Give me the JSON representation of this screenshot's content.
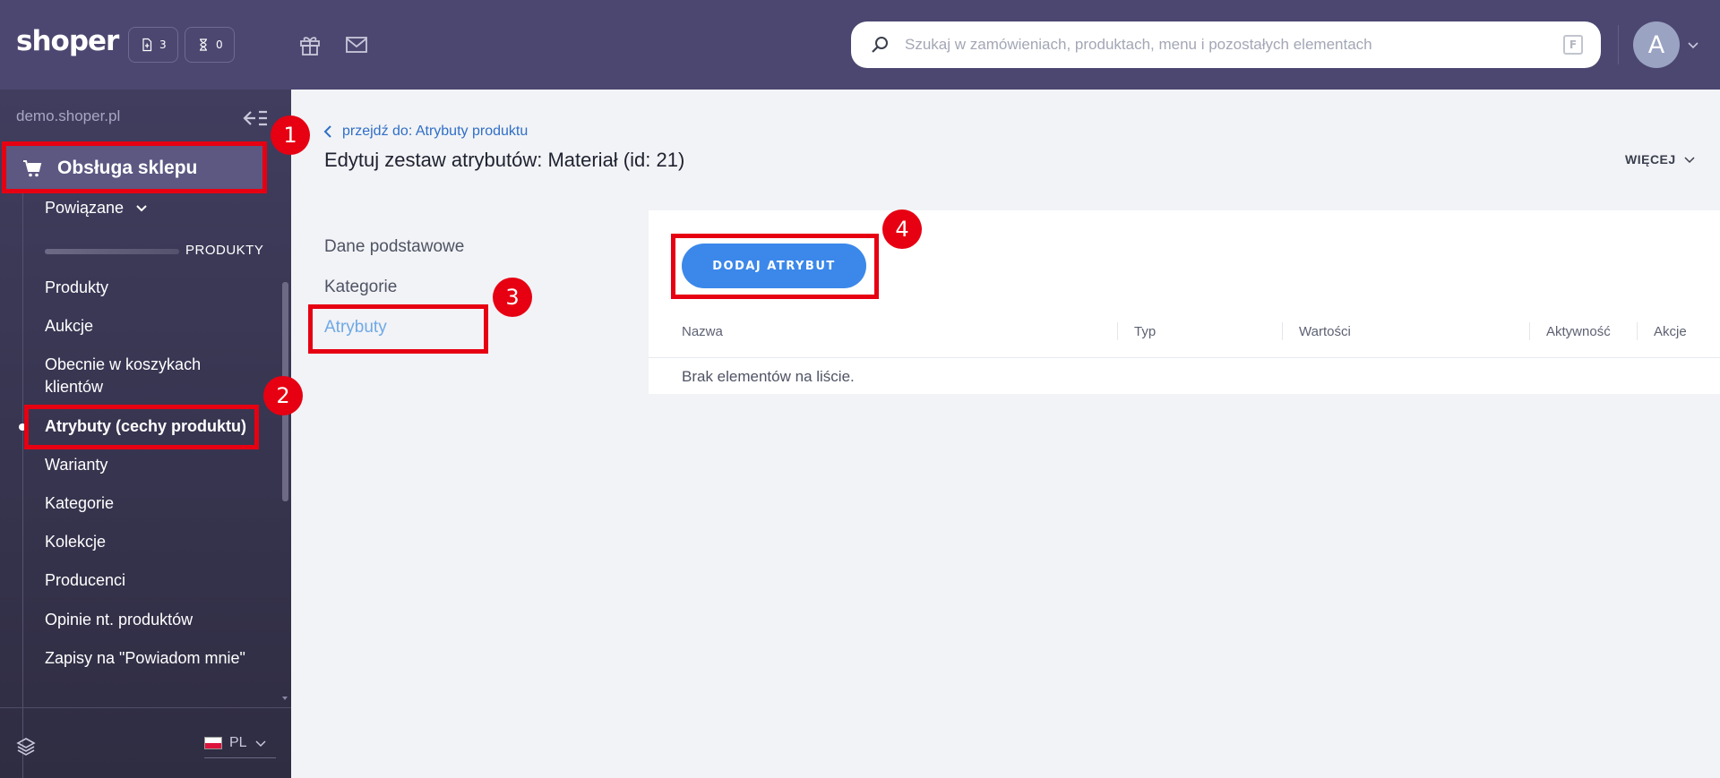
{
  "header": {
    "logo": "shoper",
    "orders_count": "3",
    "pending_count": "0",
    "search_placeholder": "Szukaj w zamówieniach, produktach, menu i pozostałych elementach",
    "search_shortcut": "F",
    "avatar_initial": "A"
  },
  "sidebar": {
    "shop_url": "demo.shoper.pl",
    "section_title": "Obsługa sklepu",
    "related_label": "Powiązane",
    "group_label": "PRODUKTY",
    "items": [
      {
        "label": "Produkty"
      },
      {
        "label": "Aukcje"
      },
      {
        "label": "Obecnie w koszykach klientów"
      },
      {
        "label": "Atrybuty (cechy produktu)"
      },
      {
        "label": "Warianty"
      },
      {
        "label": "Kategorie"
      },
      {
        "label": "Kolekcje"
      },
      {
        "label": "Producenci"
      },
      {
        "label": "Opinie nt. produktów"
      },
      {
        "label": "Zapisy na \"Powiadom mnie\""
      }
    ],
    "language": "PL"
  },
  "main": {
    "back_link": "przejdź do: Atrybuty produktu",
    "title": "Edytuj zestaw atrybutów: Materiał (id: 21)",
    "more_label": "WIĘCEJ",
    "tabs": [
      {
        "label": "Dane podstawowe"
      },
      {
        "label": "Kategorie"
      },
      {
        "label": "Atrybuty"
      }
    ],
    "add_button": "DODAJ ATRYBUT",
    "columns": [
      "Nazwa",
      "Typ",
      "Wartości",
      "Aktywność",
      "Akcje"
    ],
    "empty_message": "Brak elementów na liście."
  },
  "annotations": [
    "1",
    "2",
    "3",
    "4"
  ],
  "colors": {
    "topbar": "#4b4770",
    "accent_blue": "#3b88ea",
    "annotation_red": "#e60012",
    "active_tab": "#6fa9e6"
  }
}
